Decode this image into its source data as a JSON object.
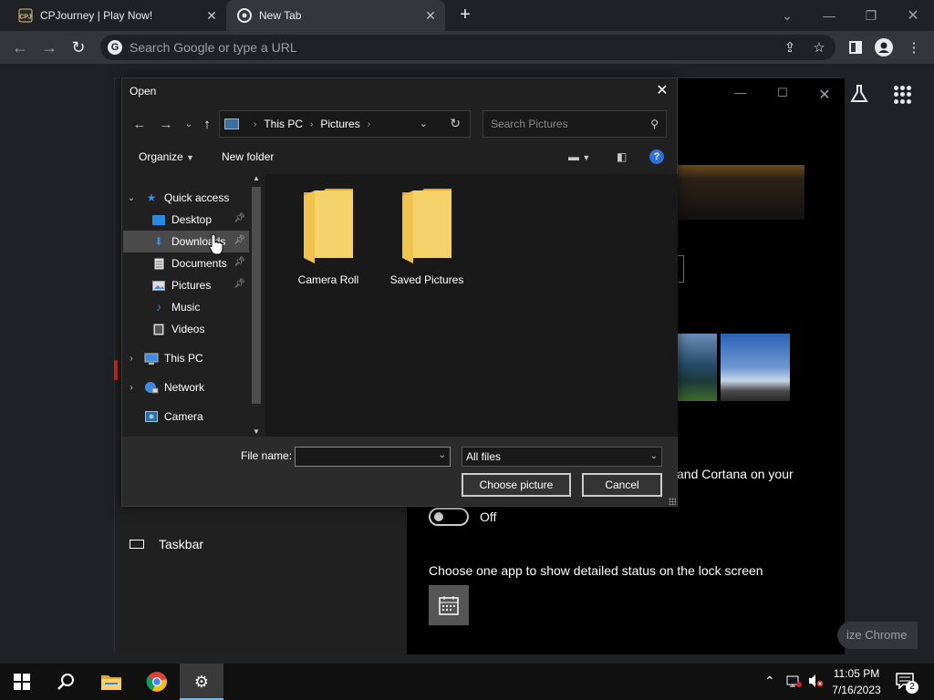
{
  "browser": {
    "tabs": [
      {
        "title": "CPJourney | Play Now!",
        "favicon": "cpjourney-icon",
        "active": false
      },
      {
        "title": "New Tab",
        "favicon": "chrome-icon",
        "active": true
      }
    ],
    "omnibox_placeholder": "Search Google or type a URL",
    "customize_label": "ize Chrome"
  },
  "settings_bg": {
    "cortana_text": "and Cortana on your",
    "toggle_label": "Off",
    "lockscreen_text": "Choose one app to show detailed status on the lock screen",
    "taskbar_label": "Taskbar"
  },
  "dialog": {
    "title": "Open",
    "breadcrumb": [
      "This PC",
      "Pictures"
    ],
    "search_placeholder": "Search Pictures",
    "organize_label": "Organize",
    "new_folder_label": "New folder",
    "nav": {
      "quick_access": "Quick access",
      "desktop": "Desktop",
      "downloads": "Downloads",
      "documents": "Documents",
      "pictures": "Pictures",
      "music": "Music",
      "videos": "Videos",
      "this_pc": "This PC",
      "network": "Network",
      "camera": "Camera"
    },
    "folders": [
      "Camera Roll",
      "Saved Pictures"
    ],
    "file_name_label": "File name:",
    "file_name_value": "",
    "file_type": "All files",
    "ok_label": "Choose picture",
    "cancel_label": "Cancel"
  },
  "system": {
    "time": "11:05 PM",
    "date": "7/16/2023",
    "notification_count": "2"
  },
  "colors": {
    "accent": "#2f6fd6",
    "folder": "#f4c95d",
    "taskbar_active": "#76b9ed"
  }
}
